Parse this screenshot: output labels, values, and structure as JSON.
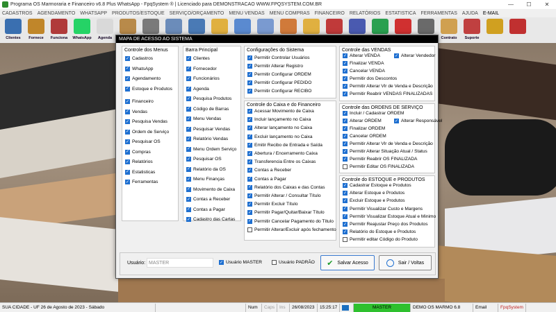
{
  "window": {
    "title": "Programa OS Marmoraria e Financeiro v6.8 Plus WhatsApp - FpqSystem ® | Licenciado para  DEMONSTRACAO WWW.FPQSYSTEM.COM.BR",
    "min": "—",
    "max": "☐",
    "close": "✕"
  },
  "menu": [
    "CADASTROS",
    "AGENDAMENTO",
    "WHATSAPP",
    "PRODUTOS/ESTOQUE",
    "SERVIÇO/ORÇAMENTO",
    "MENU VENDAS",
    "MENU COMPRAS",
    "FINANCEIRO",
    "RELATÓRIOS",
    "ESTATISTICA",
    "FERRAMENTAS",
    "AJUDA",
    "E-MAIL"
  ],
  "toolbar": [
    {
      "label": "Clientes",
      "icon": "clients-icon",
      "color": "#3a6fb0"
    },
    {
      "label": "Fornece",
      "icon": "supplier-icon",
      "color": "#c0862a"
    },
    {
      "label": "Funciona",
      "icon": "employee-icon",
      "color": "#b03a3a"
    },
    {
      "label": "WhatsApp",
      "icon": "whatsapp-icon",
      "color": "#25d366"
    },
    {
      "label": "Agenda",
      "icon": "calendar-icon",
      "color": "#d9d9d9"
    },
    {
      "label": "",
      "icon": "box-icon",
      "color": "#b88a4a"
    },
    {
      "label": "",
      "icon": "gear-icon",
      "color": "#7a7a7a"
    },
    {
      "label": "",
      "icon": "tools-icon",
      "color": "#6b8cba"
    },
    {
      "label": "",
      "icon": "report-icon",
      "color": "#4a7ab5"
    },
    {
      "label": "",
      "icon": "folder-icon",
      "color": "#e0b040"
    },
    {
      "label": "",
      "icon": "monitor-icon",
      "color": "#5a8ad0"
    },
    {
      "label": "",
      "icon": "document-icon",
      "color": "#7a9ad0"
    },
    {
      "label": "",
      "icon": "cart-icon",
      "color": "#d07a3a"
    },
    {
      "label": "",
      "icon": "folder-icon",
      "color": "#e0b040"
    },
    {
      "label": "",
      "icon": "chart-icon",
      "color": "#c03a3a"
    },
    {
      "label": "",
      "icon": "books-icon",
      "color": "#4a5ab0"
    },
    {
      "label": "",
      "icon": "money-icon",
      "color": "#2aa050"
    },
    {
      "label": "",
      "icon": "dollar-icon",
      "color": "#d03030"
    },
    {
      "label": "",
      "icon": "calculator-icon",
      "color": "#6a6a6a"
    },
    {
      "label": "Contrato",
      "icon": "contract-icon",
      "color": "#d0a050"
    },
    {
      "label": "Suporte",
      "icon": "support-icon",
      "color": "#c04040"
    },
    {
      "label": "",
      "icon": "coins-icon",
      "color": "#d0a020"
    },
    {
      "label": "",
      "icon": "exit-icon",
      "color": "#c03030"
    }
  ],
  "dialog": {
    "title": "MAPA DE ACESSO AO SISTEMA",
    "groups": {
      "menus": {
        "title": "Controle dos Menus",
        "items": [
          {
            "label": "Cadastros",
            "checked": true
          },
          {
            "label": "WhatsApp",
            "checked": true
          },
          {
            "label": "Agendamento",
            "checked": true
          },
          {
            "label": "Estoque e Produtos",
            "checked": true
          },
          {
            "label": "Financeiro",
            "checked": true
          },
          {
            "label": "Vendas",
            "checked": true
          },
          {
            "label": "Pesquisa Vendas",
            "checked": true
          },
          {
            "label": "Ordem de Serviço",
            "checked": true
          },
          {
            "label": "Pesquisar OS",
            "checked": true
          },
          {
            "label": "Compras",
            "checked": true
          },
          {
            "label": "Relatórios",
            "checked": true
          },
          {
            "label": "Estatisticas",
            "checked": true
          },
          {
            "label": "Ferramentas",
            "checked": true
          }
        ]
      },
      "barra": {
        "title": "Barra Principal",
        "items": [
          {
            "label": "Clientes",
            "checked": true
          },
          {
            "label": "Fornecedor",
            "checked": true
          },
          {
            "label": "Funcionários",
            "checked": true
          },
          {
            "label": "Agenda",
            "checked": true
          },
          {
            "label": "Pesquisa Produtos",
            "checked": true
          },
          {
            "label": "Código de Barras",
            "checked": true
          },
          {
            "label": "Menu Vendas",
            "checked": true
          },
          {
            "label": "Pesquisar Vendas",
            "checked": true
          },
          {
            "label": "Relatório Vendas",
            "checked": true
          },
          {
            "label": "Menu Ordem Serviço",
            "checked": true
          },
          {
            "label": "Pesquisar OS",
            "checked": true
          },
          {
            "label": "Relatório da OS",
            "checked": true
          },
          {
            "label": "Menu Finanças",
            "checked": true
          },
          {
            "label": "Movimento de Caixa",
            "checked": true
          },
          {
            "label": "Contas a Receber",
            "checked": true
          },
          {
            "label": "Contas a Pagar",
            "checked": true
          },
          {
            "label": "Cadastro das Cartas",
            "checked": true
          }
        ]
      },
      "config": {
        "title": "Configurações do Sistema",
        "items": [
          {
            "label": "Permitir Controlar Usuários",
            "checked": true
          },
          {
            "label": "Permitir Alterar Registro",
            "checked": true
          },
          {
            "label": "Permitir Configurar ORDEM",
            "checked": true
          },
          {
            "label": "Permitir Configurar PEDIDO",
            "checked": true
          },
          {
            "label": "Permitir Configurar RECIBO",
            "checked": true
          }
        ]
      },
      "caixa": {
        "title": "Controle do Caixa e do Financeiro",
        "items": [
          {
            "label": "Acessar Movimento de Caixa",
            "checked": true
          },
          {
            "label": "Incluir lançamento no Caixa",
            "checked": true
          },
          {
            "label": "Alterar lançamento no Caixa",
            "checked": true
          },
          {
            "label": "Excluir lançamento no Caixa",
            "checked": true
          },
          {
            "label": "Emitir Recibo de Entrada e Saída",
            "checked": true
          },
          {
            "label": "Abertura / Encerramento Caixa",
            "checked": true
          },
          {
            "label": "Transferencia Entre os Caixas",
            "checked": true
          },
          {
            "label": "Contas a Receber",
            "checked": true
          },
          {
            "label": "Contas a Pagar",
            "checked": true
          },
          {
            "label": "Relatório dos Caixas e das Contas",
            "checked": true
          },
          {
            "label": "Permitir Alterar / Consultar Título",
            "checked": true
          },
          {
            "label": "Permitir Excluir Título",
            "checked": true
          },
          {
            "label": "Permitir Pagar/Quitar/Baixar Título",
            "checked": true
          },
          {
            "label": "Permitir Cancelar Pagamento do Título",
            "checked": true
          },
          {
            "label": "Permitir Alterar/Excluir após fechamento",
            "checked": false
          }
        ]
      },
      "vendas": {
        "title": "Controle das VENDAS",
        "items": [
          {
            "label": "Alterar VENDA",
            "checked": true
          },
          {
            "label": "Alterar Vendedor",
            "checked": true
          },
          {
            "label": "Finalizar VENDA",
            "checked": true
          },
          {
            "label": "Cancelar VENDA",
            "checked": true
          },
          {
            "label": "Permitir dos Descontos",
            "checked": true
          },
          {
            "label": "Permitir Alterar Vlr de Venda e Descrição",
            "checked": true
          },
          {
            "label": "Permitir Reabrir VENDAS FINALIZADAS",
            "checked": true
          }
        ]
      },
      "ordens": {
        "title": "Controle das ORDENS DE SERVIÇO",
        "items": [
          {
            "label": "Incluir / Cadastrar ORDEM",
            "checked": true
          },
          {
            "label": "Alterar ORDEM",
            "checked": true
          },
          {
            "label": "Alterar Responsável",
            "checked": true
          },
          {
            "label": "Finalizar ORDEM",
            "checked": true
          },
          {
            "label": "Cancelar ORDEM",
            "checked": true
          },
          {
            "label": "Permitir Alterar Vlr de Venda e Descrição",
            "checked": true
          },
          {
            "label": "Permitir Alterar Situação Atual / Status",
            "checked": true
          },
          {
            "label": "Permitir Reabrir OS FINALIZADA",
            "checked": true
          },
          {
            "label": "Permitir Editar OS FINALIZADA",
            "checked": false
          }
        ]
      },
      "estoque": {
        "title": "Controle do ESTOQUE e PRODUTOS",
        "items": [
          {
            "label": "Cadastrar Estoque e Produtos",
            "checked": true
          },
          {
            "label": "Alterar Estoque e Produtos",
            "checked": true
          },
          {
            "label": "Excluir Estoque e Produtos",
            "checked": true
          },
          {
            "label": "Permitir Visualizar Custo e Margens",
            "checked": true
          },
          {
            "label": "Permitir Visualizar Estoque Atual e Minimo",
            "checked": true
          },
          {
            "label": "Permitir Reajustar Preço dos Produtos",
            "checked": true
          },
          {
            "label": "Relatório do Estoque e Produtos",
            "checked": true
          },
          {
            "label": "Permitir editar Código do Produto",
            "checked": false
          }
        ]
      }
    },
    "footer": {
      "user_label": "Usuário:",
      "user_value": "MASTER",
      "master_label": "Usuário MASTER",
      "master_checked": true,
      "padrao_label": "Usuário PADRÃO",
      "padrao_checked": false,
      "save_label": "Salvar Acesso",
      "exit_label": "Sair / Voltas"
    }
  },
  "statusbar": {
    "city": "SUA CIDADE - UF 26 de Agosto de 2023 - Sábado",
    "num": "Num",
    "caps": "Caps",
    "ins": "Ins",
    "date": "26/08/2023",
    "time": "15:25:17",
    "user": "MASTER",
    "demo": "DEMO OS MARMO 6.8",
    "email": "Email",
    "brand": "FpqSystem"
  }
}
